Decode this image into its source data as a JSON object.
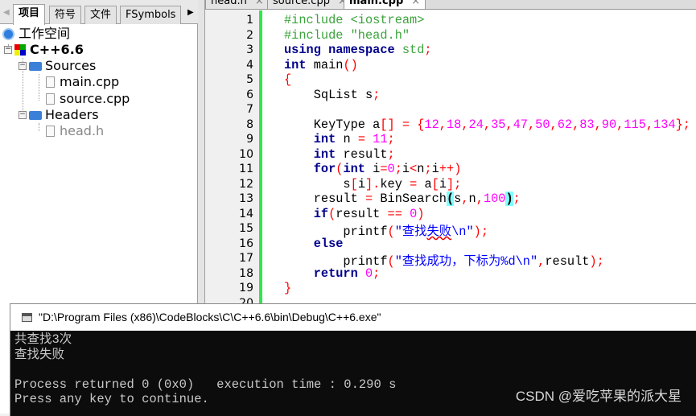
{
  "left_panel": {
    "tabs": [
      {
        "label": "项目",
        "active": true
      },
      {
        "label": "符号"
      },
      {
        "label": "文件"
      },
      {
        "label": "FSymbols"
      }
    ],
    "tree": {
      "workspace": "工作空间",
      "project": "C++6.6",
      "sources_folder": "Sources",
      "sources": [
        "main.cpp",
        "source.cpp"
      ],
      "headers_folder": "Headers",
      "headers": [
        "head.h"
      ]
    }
  },
  "editor": {
    "tabs": [
      {
        "label": "head.h"
      },
      {
        "label": "source.cpp"
      },
      {
        "label": "main.cpp",
        "active": true
      }
    ],
    "close_glyph": "×",
    "lines": [
      [
        [
          "#include <iostream>",
          "pp"
        ]
      ],
      [
        [
          "#include \"head.h\"",
          "pp"
        ]
      ],
      [
        [
          "using namespace ",
          "kw"
        ],
        [
          "std",
          "pp"
        ],
        [
          ";",
          "op"
        ]
      ],
      [
        [
          "int",
          "kw"
        ],
        [
          " main",
          "id"
        ],
        [
          "()",
          "op"
        ]
      ],
      [
        [
          "{",
          "op"
        ]
      ],
      [
        [
          "    SqList s",
          "id"
        ],
        [
          ";",
          "op"
        ]
      ],
      [],
      [
        [
          "    KeyType a",
          "id"
        ],
        [
          "[] = {",
          "op"
        ],
        [
          "12",
          "num"
        ],
        [
          ",",
          "op"
        ],
        [
          "18",
          "num"
        ],
        [
          ",",
          "op"
        ],
        [
          "24",
          "num"
        ],
        [
          ",",
          "op"
        ],
        [
          "35",
          "num"
        ],
        [
          ",",
          "op"
        ],
        [
          "47",
          "num"
        ],
        [
          ",",
          "op"
        ],
        [
          "50",
          "num"
        ],
        [
          ",",
          "op"
        ],
        [
          "62",
          "num"
        ],
        [
          ",",
          "op"
        ],
        [
          "83",
          "num"
        ],
        [
          ",",
          "op"
        ],
        [
          "90",
          "num"
        ],
        [
          ",",
          "op"
        ],
        [
          "115",
          "num"
        ],
        [
          ",",
          "op"
        ],
        [
          "134",
          "num"
        ],
        [
          "};",
          "op"
        ]
      ],
      [
        [
          "    ",
          "id"
        ],
        [
          "int",
          "kw"
        ],
        [
          " n ",
          "id"
        ],
        [
          "=",
          "op"
        ],
        [
          " ",
          "id"
        ],
        [
          "11",
          "num"
        ],
        [
          ";",
          "op"
        ]
      ],
      [
        [
          "    ",
          "id"
        ],
        [
          "int",
          "kw"
        ],
        [
          " result",
          "id"
        ],
        [
          ";",
          "op"
        ]
      ],
      [
        [
          "    ",
          "id"
        ],
        [
          "for",
          "kw"
        ],
        [
          "(",
          "op"
        ],
        [
          "int",
          "kw"
        ],
        [
          " i",
          "id"
        ],
        [
          "=",
          "op"
        ],
        [
          "0",
          "num"
        ],
        [
          ";",
          "op"
        ],
        [
          "i",
          "id"
        ],
        [
          "<",
          "op"
        ],
        [
          "n",
          "id"
        ],
        [
          ";",
          "op"
        ],
        [
          "i",
          "id"
        ],
        [
          "++)",
          "op"
        ]
      ],
      [
        [
          "        s",
          "id"
        ],
        [
          "[",
          "op"
        ],
        [
          "i",
          "id"
        ],
        [
          "].",
          "op"
        ],
        [
          "key ",
          "id"
        ],
        [
          "=",
          "op"
        ],
        [
          " a",
          "id"
        ],
        [
          "[",
          "op"
        ],
        [
          "i",
          "id"
        ],
        [
          "];",
          "op"
        ]
      ],
      [
        [
          "    result ",
          "id"
        ],
        [
          "=",
          "op"
        ],
        [
          " BinSearch",
          "id"
        ],
        [
          "(",
          "hl"
        ],
        [
          "s",
          "id"
        ],
        [
          ",",
          "op"
        ],
        [
          "n",
          "id"
        ],
        [
          ",",
          "op"
        ],
        [
          "100",
          "num"
        ],
        [
          ")",
          "hl"
        ],
        [
          ";",
          "op"
        ]
      ],
      [
        [
          "    ",
          "id"
        ],
        [
          "if",
          "kw"
        ],
        [
          "(",
          "op"
        ],
        [
          "result ",
          "id"
        ],
        [
          "==",
          "op"
        ],
        [
          " ",
          "id"
        ],
        [
          "0",
          "num"
        ],
        [
          ")",
          "op"
        ]
      ],
      [
        [
          "        printf",
          "id"
        ],
        [
          "(",
          "op"
        ],
        [
          "\"查找",
          "str"
        ],
        [
          "失败",
          "str sq"
        ],
        [
          "\\n\"",
          "str"
        ],
        [
          ");",
          "op"
        ]
      ],
      [
        [
          "    ",
          "id"
        ],
        [
          "else",
          "kw"
        ]
      ],
      [
        [
          "        printf",
          "id"
        ],
        [
          "(",
          "op"
        ],
        [
          "\"查找成功，下标为%d\\n\"",
          "str"
        ],
        [
          ",",
          "op"
        ],
        [
          "result",
          "id"
        ],
        [
          ");",
          "op"
        ]
      ],
      [
        [
          "    ",
          "id"
        ],
        [
          "return",
          "kw"
        ],
        [
          " ",
          "id"
        ],
        [
          "0",
          "num"
        ],
        [
          ";",
          "op"
        ]
      ],
      [
        [
          "}",
          "op"
        ]
      ]
    ]
  },
  "console": {
    "title": "\"D:\\Program Files (x86)\\CodeBlocks\\C\\C++6.6\\bin\\Debug\\C++6.exe\"",
    "output": "共查找3次\n查找失败\n\nProcess returned 0 (0x0)   execution time : 0.290 s\nPress any key to continue.",
    "watermark": "CSDN @爱吃苹果的派大星"
  },
  "colors": {
    "preprocessor": "#3ca33c",
    "keyword": "#00008b",
    "operator": "#ff0000",
    "number": "#ff00ff",
    "string": "#0000ff",
    "brace_highlight": "#80ffff",
    "change_bar": "#2ee84a"
  }
}
